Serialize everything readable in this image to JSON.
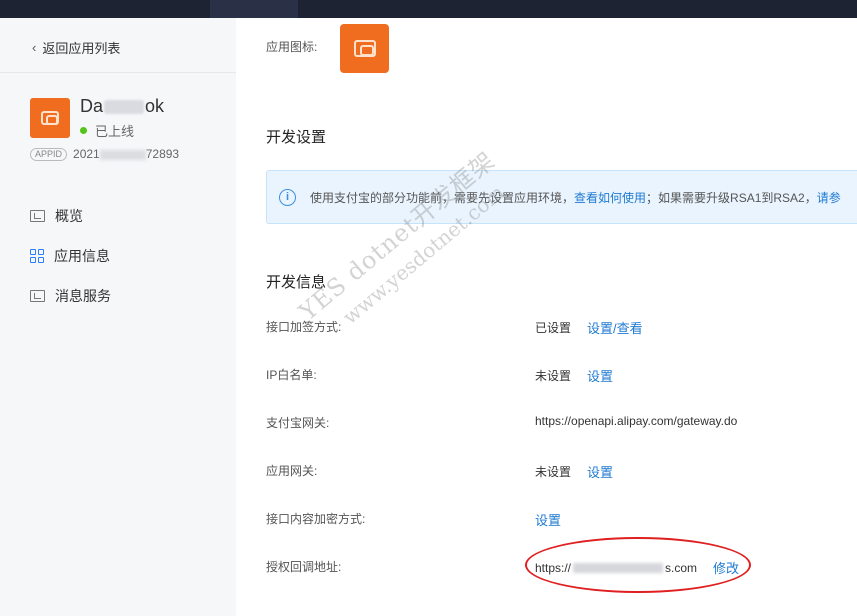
{
  "sidebar": {
    "back_label": "返回应用列表",
    "app": {
      "name_prefix": "Da",
      "name_suffix": "ok",
      "status": "已上线",
      "appid_badge": "APPID",
      "appid_prefix": "2021",
      "appid_suffix": "72893"
    },
    "nav": [
      {
        "label": "概览",
        "icon": "monitor-icon"
      },
      {
        "label": "应用信息",
        "icon": "grid-icon"
      },
      {
        "label": "消息服务",
        "icon": "chart-icon"
      }
    ]
  },
  "main": {
    "app_icon_label": "应用图标:",
    "dev_settings_title": "开发设置",
    "notice": {
      "text_before": "使用支付宝的部分功能前，需要先设置应用环境，",
      "link1": "查看如何使用",
      "text_middle": "；如果需要升级RSA1到RSA2，",
      "link2": "请参"
    },
    "dev_info_title": "开发信息",
    "rows": [
      {
        "key": "接口加签方式:",
        "value": "已设置",
        "action": "设置/查看"
      },
      {
        "key": "IP白名单:",
        "value": "未设置",
        "action": "设置"
      },
      {
        "key": "支付宝网关:",
        "value": "https://openapi.alipay.com/gateway.do",
        "action": ""
      },
      {
        "key": "应用网关:",
        "value": "未设置",
        "action": "设置"
      },
      {
        "key": "接口内容加密方式:",
        "value": "",
        "action": "设置"
      },
      {
        "key": "授权回调地址:",
        "value_prefix": "https://",
        "value_suffix": "s.com",
        "action": "修改"
      }
    ]
  },
  "watermark": {
    "line1": "YES dotnet开发框架",
    "line2": "www.yesdotnet.com"
  },
  "colors": {
    "brand_orange": "#f06c1e",
    "link_blue": "#1f7ad1",
    "online_green": "#52c41a",
    "highlight_red": "#e02020"
  }
}
